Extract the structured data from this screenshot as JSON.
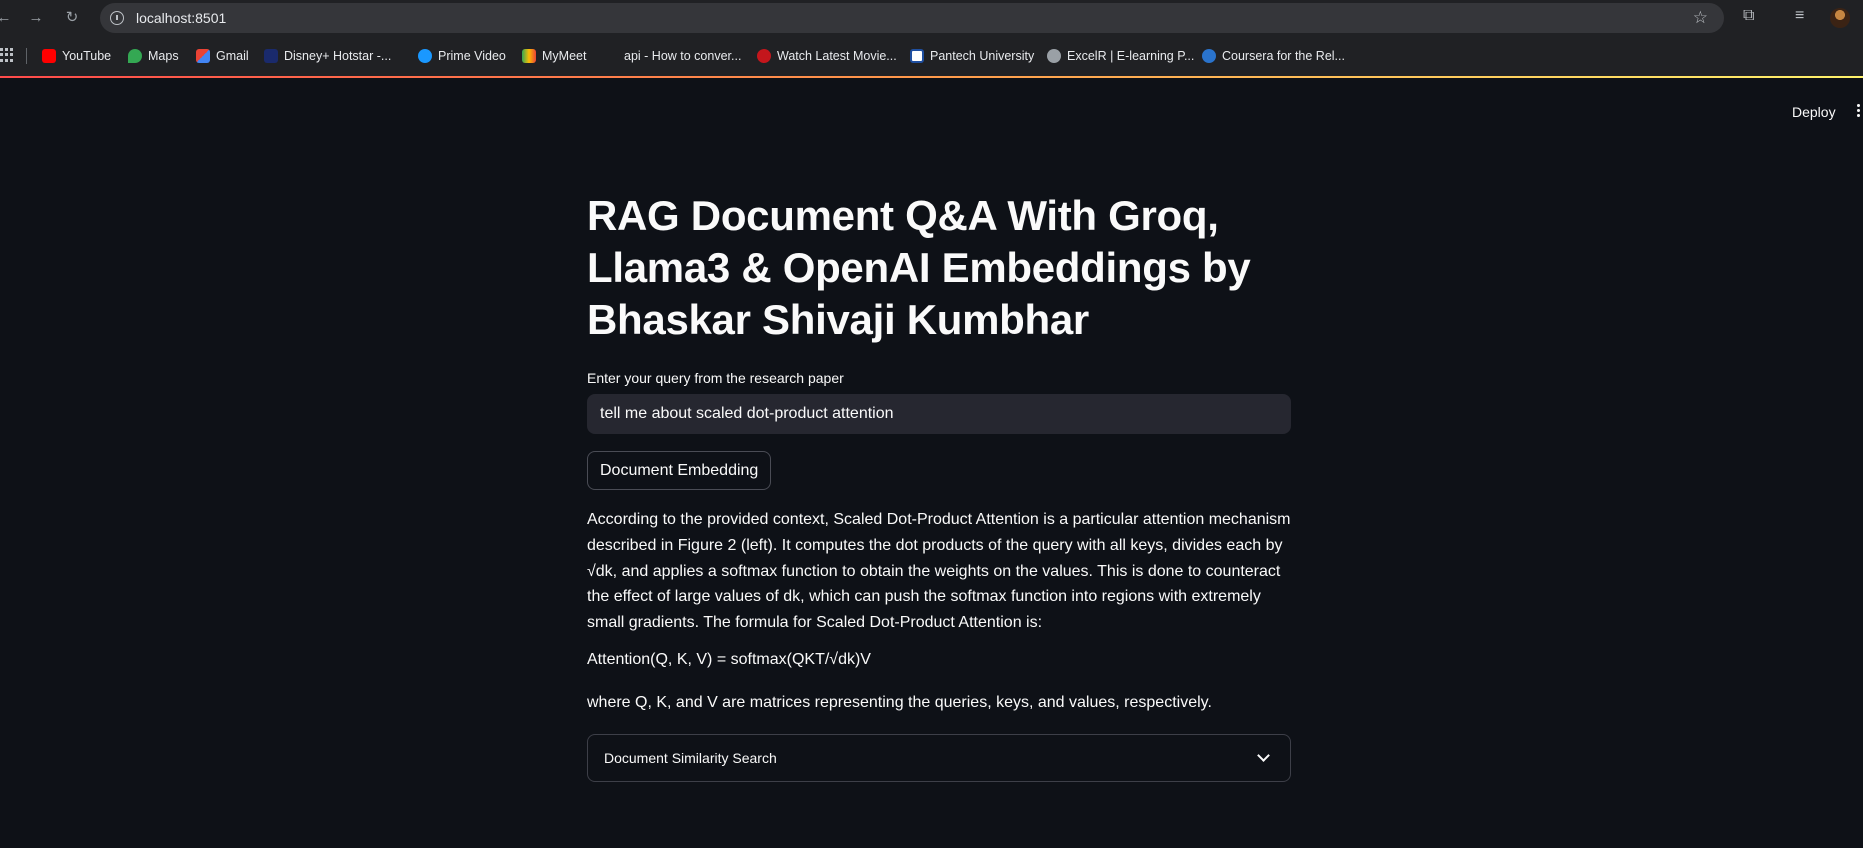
{
  "browser": {
    "url": "localhost:8501",
    "bookmarks": [
      {
        "label": "YouTube",
        "icon": "youtube-icon",
        "color": "#ff0000"
      },
      {
        "label": "Maps",
        "icon": "maps-icon",
        "color": "#34a853"
      },
      {
        "label": "Gmail",
        "icon": "gmail-icon",
        "color": "#ea4335"
      },
      {
        "label": "Disney+ Hotstar -...",
        "icon": "hotstar-icon",
        "color": "#1a2a6c"
      },
      {
        "label": "Prime Video",
        "icon": "prime-video-icon",
        "color": "#1a98ff"
      },
      {
        "label": "MyMeet",
        "icon": "mymeet-icon",
        "color": "#fbbc04"
      },
      {
        "label": "api - How to conver...",
        "icon": "",
        "color": ""
      },
      {
        "label": "Watch Latest Movie...",
        "icon": "movie-icon",
        "color": "#c4161c"
      },
      {
        "label": "Pantech University",
        "icon": "pantech-icon",
        "color": "#ffffff"
      },
      {
        "label": "ExcelR | E-learning P...",
        "icon": "globe-icon",
        "color": "#9aa0a6"
      },
      {
        "label": "Coursera for the Rel...",
        "icon": "coursera-icon",
        "color": "#2a73cc"
      }
    ]
  },
  "app": {
    "deploy_label": "Deploy",
    "title": "RAG Document Q&A With Groq, Llama3 & OpenAI Embeddings by Bhaskar Shivaji Kumbhar",
    "query_label": "Enter your query from the research paper",
    "query_value": "tell me about scaled dot-product attention",
    "embed_button": "Document Embedding",
    "answer": "According to the provided context, Scaled Dot-Product Attention is a particular attention mechanism described in Figure 2 (left). It computes the dot products of the query with all keys, divides each by √dk, and applies a softmax function to obtain the weights on the values. This is done to counteract the effect of large values of dk, which can push the softmax function into regions with extremely small gradients. The formula for Scaled Dot-Product Attention is:",
    "formula": "Attention(Q, K, V) = softmax(QKT/√dk)V",
    "where": "where Q, K, and V are matrices representing the queries, keys, and values, respectively.",
    "expander_label": "Document Similarity Search"
  }
}
